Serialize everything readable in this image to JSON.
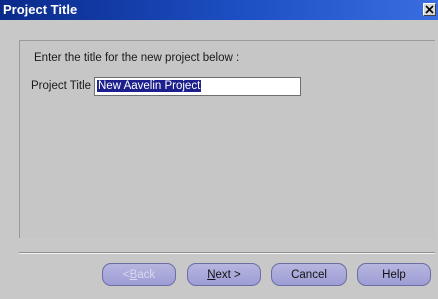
{
  "window": {
    "title": "Project Title"
  },
  "main": {
    "instruction": "Enter the title for the new project below :",
    "field_label": "Project Title :",
    "field_value": "New Aavelin Project"
  },
  "buttons": {
    "back": {
      "mnemonic": "B",
      "rest": "ack",
      "prefix": "< "
    },
    "next": {
      "mnemonic": "N",
      "rest": "ext >"
    },
    "cancel": "Cancel",
    "help": "Help"
  },
  "icons": {
    "close": "close-icon"
  },
  "colors": {
    "titlebar_start": "#0a2a8a",
    "titlebar_end": "#3a6ee0",
    "button_fill": "#9d9dd6",
    "selection": "#1c1f8c"
  }
}
